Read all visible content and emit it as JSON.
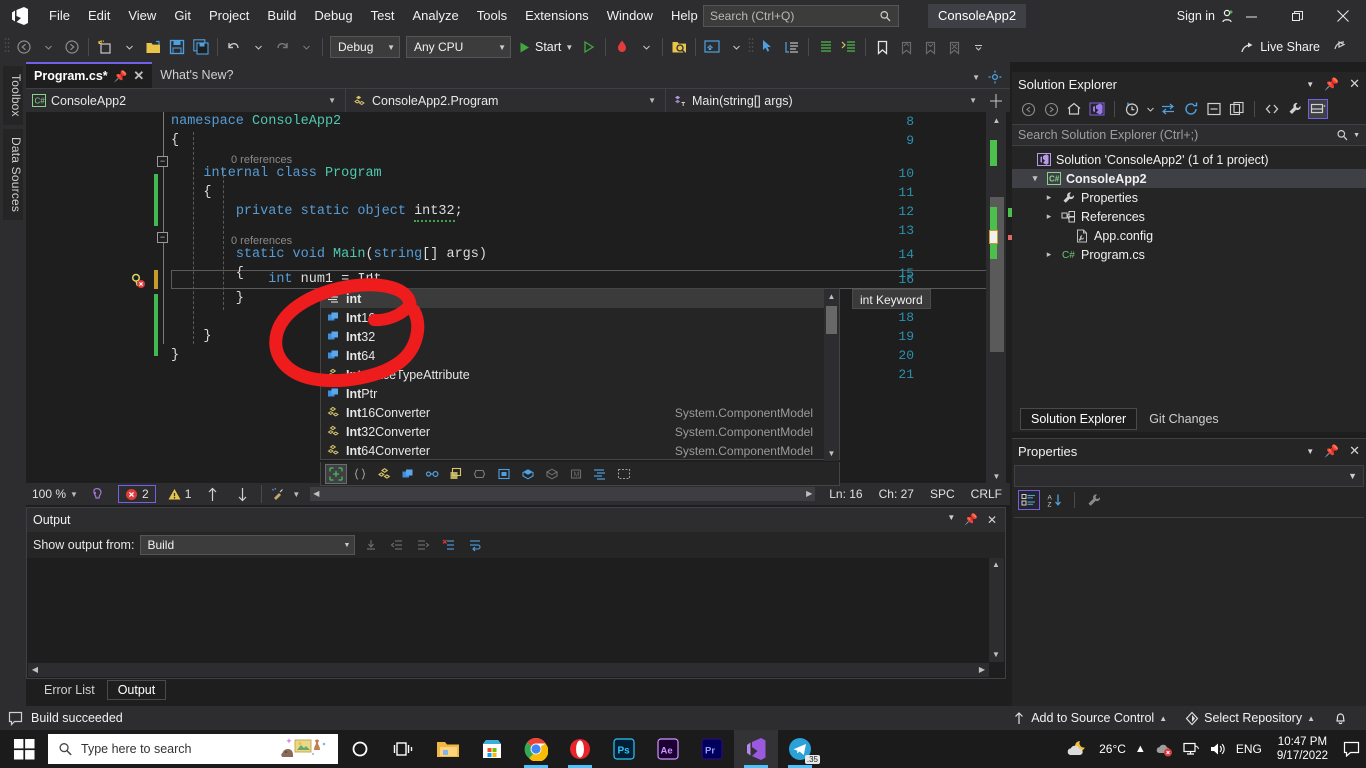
{
  "app": {
    "title": "ConsoleApp2",
    "sign_in": "Sign in",
    "live_share": "Live Share"
  },
  "menu": {
    "items": [
      {
        "label": "File"
      },
      {
        "label": "Edit"
      },
      {
        "label": "View"
      },
      {
        "label": "Git"
      },
      {
        "label": "Project"
      },
      {
        "label": "Build"
      },
      {
        "label": "Debug"
      },
      {
        "label": "Test"
      },
      {
        "label": "Analyze"
      },
      {
        "label": "Tools"
      },
      {
        "label": "Extensions"
      },
      {
        "label": "Window"
      },
      {
        "label": "Help"
      }
    ]
  },
  "search": {
    "placeholder": "Search (Ctrl+Q)",
    "icon": "search-icon"
  },
  "toolbar": {
    "config": "Debug",
    "platform": "Any CPU",
    "start_label": "Start",
    "icons": [
      "back-icon",
      "forward-icon",
      "new-item-icon",
      "open-file-icon",
      "save-icon",
      "save-all-icon",
      "undo-icon",
      "redo-icon"
    ]
  },
  "left_rail": {
    "tabs": [
      "Toolbox",
      "Data Sources"
    ]
  },
  "editor": {
    "tabs": [
      {
        "label": "Program.cs*",
        "active": true,
        "dirty": true
      },
      {
        "label": "What's New?",
        "active": false
      }
    ],
    "nav": {
      "project": "ConsoleApp2",
      "type": "ConsoleApp2.Program",
      "member": "Main(string[] args)"
    },
    "lines": [
      {
        "n": "8",
        "html": "<span class='k'>namespace</span> <span class='t'>ConsoleApp2</span>"
      },
      {
        "n": "9",
        "html": "{"
      },
      {
        "n": "10",
        "html": "    <span class='k'>internal</span> <span class='k'>class</span> <span class='t'>Program</span>",
        "ref": "0 references"
      },
      {
        "n": "11",
        "html": "    {"
      },
      {
        "n": "12",
        "html": "        <span class='k'>private</span> <span class='k'>static</span> <span class='k'>object</span> <span class='squig'>int32</span>;"
      },
      {
        "n": "13",
        "html": ""
      },
      {
        "n": "14",
        "html": "        <span class='k'>static</span> <span class='k'>void</span> <span class='t'>Main</span>(<span class='k'>string</span>[] args)",
        "ref": "0 references"
      },
      {
        "n": "15",
        "html": "        {"
      },
      {
        "n": "16",
        "html": "            <span class='k'>int</span> num1 = Int"
      },
      {
        "n": "17",
        "html": "        }"
      },
      {
        "n": "18",
        "html": ""
      },
      {
        "n": "19",
        "html": "    }"
      },
      {
        "n": "20",
        "html": "}"
      },
      {
        "n": "21",
        "html": ""
      }
    ],
    "status": {
      "zoom": "100 %",
      "error_count": "2",
      "warning_count": "1",
      "line": "Ln: 16",
      "col": "Ch: 27",
      "spaces": "SPC",
      "eol": "CRLF"
    }
  },
  "intellisense": {
    "tooltip": "int Keyword",
    "items": [
      {
        "label_bold": "int",
        "label_rest": "",
        "icon": "keyword-icon",
        "ns": "",
        "selected": true
      },
      {
        "label_bold": "Int",
        "label_rest": "16",
        "icon": "struct-icon",
        "ns": "",
        "selected": false
      },
      {
        "label_bold": "Int",
        "label_rest": "32",
        "icon": "struct-icon",
        "ns": "",
        "selected": false
      },
      {
        "label_bold": "Int",
        "label_rest": "64",
        "icon": "struct-icon",
        "ns": "",
        "selected": false
      },
      {
        "label_bold": "Int",
        "label_rest": "erfaceTypeAttribute",
        "icon": "class-icon",
        "ns": "",
        "selected": false
      },
      {
        "label_bold": "Int",
        "label_rest": "Ptr",
        "icon": "struct-icon",
        "ns": "",
        "selected": false
      },
      {
        "label_bold": "Int",
        "label_rest": "16Converter",
        "icon": "class-icon",
        "ns": "System.ComponentModel",
        "selected": false
      },
      {
        "label_bold": "Int",
        "label_rest": "32Converter",
        "icon": "class-icon",
        "ns": "System.ComponentModel",
        "selected": false
      },
      {
        "label_bold": "Int",
        "label_rest": "64Converter",
        "icon": "class-icon",
        "ns": "System.ComponentModel",
        "selected": false
      }
    ],
    "filters": [
      "all-filter",
      "snippet-filter",
      "namespace-filter",
      "class-filter",
      "struct-filter",
      "interface-filter",
      "enum-filter",
      "delegate-filter",
      "event-filter",
      "field-filter",
      "property-filter",
      "method-filter",
      "extension-filter",
      "keyword-filter"
    ]
  },
  "solution_explorer": {
    "title": "Solution Explorer",
    "search_placeholder": "Search Solution Explorer (Ctrl+;)",
    "tree": [
      {
        "label": "Solution 'ConsoleApp2' (1 of 1 project)",
        "indent": 0,
        "twig": "",
        "icon": "solution-icon",
        "selected": false
      },
      {
        "label": "ConsoleApp2",
        "indent": 1,
        "twig": "▾",
        "icon": "csproj-icon",
        "selected": true
      },
      {
        "label": "Properties",
        "indent": 2,
        "twig": "▸",
        "icon": "wrench-icon",
        "selected": false
      },
      {
        "label": "References",
        "indent": 2,
        "twig": "▸",
        "icon": "references-icon",
        "selected": false
      },
      {
        "label": "App.config",
        "indent": 3,
        "twig": "",
        "icon": "config-icon",
        "selected": false
      },
      {
        "label": "Program.cs",
        "indent": 2,
        "twig": "▸",
        "icon": "cs-file-icon",
        "selected": false
      }
    ],
    "tabs": [
      {
        "label": "Solution Explorer",
        "active": true
      },
      {
        "label": "Git Changes",
        "active": false
      }
    ]
  },
  "properties_panel": {
    "title": "Properties"
  },
  "output_panel": {
    "title": "Output",
    "show_from_label": "Show output from:",
    "show_from_value": "Build",
    "tabs": [
      {
        "label": "Error List",
        "active": false
      },
      {
        "label": "Output",
        "active": true
      }
    ]
  },
  "vs_status": {
    "build_message": "Build succeeded",
    "add_source_control": "Add to Source Control",
    "select_repository": "Select Repository"
  },
  "taskbar": {
    "search_placeholder": "Type here to search",
    "apps": [
      "cortana-icon",
      "task-view-icon",
      "file-explorer-icon",
      "microsoft-store-icon",
      "chrome-icon",
      "opera-icon",
      "photoshop-icon",
      "after-effects-icon",
      "premiere-pro-icon",
      "visual-studio-icon",
      "telegram-icon"
    ],
    "weather": "26°C",
    "language": "ENG",
    "time": "10:47 PM",
    "date": "9/17/2022"
  },
  "colors": {
    "accent_purple": "#7160e8",
    "keyword_blue": "#569cd6",
    "type_teal": "#4ec9b0",
    "linenum_blue": "#2b91af",
    "annotation_red": "#ee1c1c",
    "green_change": "#3fb950"
  }
}
